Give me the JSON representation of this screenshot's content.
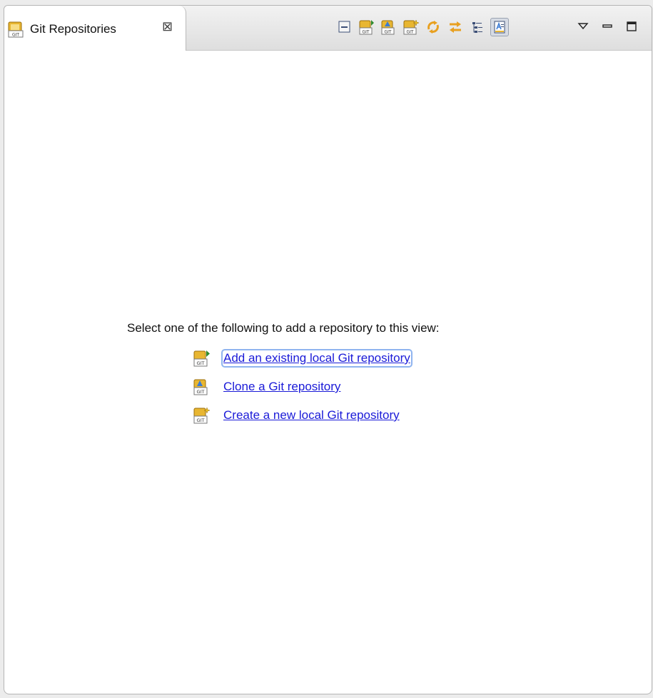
{
  "tab": {
    "title": "Git Repositories",
    "close_glyph": "⊠",
    "icon": "git-repository-icon"
  },
  "toolbar": {
    "buttons": [
      {
        "icon": "collapse-all-icon"
      },
      {
        "icon": "add-repository-icon"
      },
      {
        "icon": "clone-repository-icon"
      },
      {
        "icon": "create-repository-icon"
      },
      {
        "icon": "refresh-icon"
      },
      {
        "icon": "link-with-selection-icon"
      },
      {
        "icon": "hierarchical-layout-icon"
      },
      {
        "icon": "show-details-icon",
        "pressed": true
      }
    ],
    "view_menu_icon": "view-menu-icon",
    "minimize_icon": "minimize-icon",
    "maximize_icon": "maximize-icon"
  },
  "content": {
    "prompt": "Select one of the following to add a repository to this view:",
    "links": [
      {
        "label": "Add an existing local Git repository",
        "icon": "add-repository-icon"
      },
      {
        "label": "Clone a Git repository",
        "icon": "clone-repository-icon"
      },
      {
        "label": "Create a new local Git repository",
        "icon": "create-repository-icon"
      }
    ]
  },
  "colors": {
    "link": "#1a1ad8",
    "accent_yellow": "#e8b631",
    "toolbar_bg": "#dedede"
  }
}
